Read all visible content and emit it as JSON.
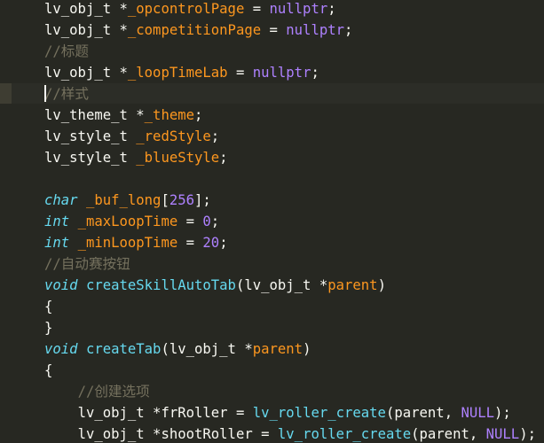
{
  "editor": {
    "lines": [
      {
        "indent": "",
        "tokens": [
          [
            "cls",
            "lv_obj_t"
          ],
          [
            "op",
            " *"
          ],
          [
            "var",
            "_opcontrolPage"
          ],
          [
            "op",
            " = "
          ],
          [
            "kw",
            "nullptr"
          ],
          [
            "punc",
            ";"
          ]
        ]
      },
      {
        "indent": "",
        "tokens": [
          [
            "cls",
            "lv_obj_t"
          ],
          [
            "op",
            " *"
          ],
          [
            "var",
            "_competitionPage"
          ],
          [
            "op",
            " = "
          ],
          [
            "kw",
            "nullptr"
          ],
          [
            "punc",
            ";"
          ]
        ]
      },
      {
        "indent": "",
        "tokens": [
          [
            "com",
            "//标题"
          ]
        ]
      },
      {
        "indent": "",
        "tokens": [
          [
            "cls",
            "lv_obj_t"
          ],
          [
            "op",
            " *"
          ],
          [
            "var",
            "_loopTimeLab"
          ],
          [
            "op",
            " = "
          ],
          [
            "kw",
            "nullptr"
          ],
          [
            "punc",
            ";"
          ]
        ]
      },
      {
        "indent": "",
        "tokens": [
          [
            "com",
            "//样式"
          ]
        ]
      },
      {
        "indent": "",
        "tokens": [
          [
            "cls",
            "lv_theme_t"
          ],
          [
            "op",
            " *"
          ],
          [
            "var",
            "_theme"
          ],
          [
            "punc",
            ";"
          ]
        ]
      },
      {
        "indent": "",
        "tokens": [
          [
            "cls",
            "lv_style_t"
          ],
          [
            "plain",
            " "
          ],
          [
            "var",
            "_redStyle"
          ],
          [
            "punc",
            ";"
          ]
        ]
      },
      {
        "indent": "",
        "tokens": [
          [
            "cls",
            "lv_style_t"
          ],
          [
            "plain",
            " "
          ],
          [
            "var",
            "_blueStyle"
          ],
          [
            "punc",
            ";"
          ]
        ]
      },
      {
        "indent": "",
        "tokens": []
      },
      {
        "indent": "",
        "tokens": [
          [
            "type",
            "char"
          ],
          [
            "plain",
            " "
          ],
          [
            "var",
            "_buf_long"
          ],
          [
            "punc",
            "["
          ],
          [
            "num",
            "256"
          ],
          [
            "punc",
            "];"
          ]
        ]
      },
      {
        "indent": "",
        "tokens": [
          [
            "type",
            "int"
          ],
          [
            "plain",
            " "
          ],
          [
            "var",
            "_maxLoopTime"
          ],
          [
            "op",
            " = "
          ],
          [
            "num",
            "0"
          ],
          [
            "punc",
            ";"
          ]
        ]
      },
      {
        "indent": "",
        "tokens": [
          [
            "type",
            "int"
          ],
          [
            "plain",
            " "
          ],
          [
            "var",
            "_minLoopTime"
          ],
          [
            "op",
            " = "
          ],
          [
            "num",
            "20"
          ],
          [
            "punc",
            ";"
          ]
        ]
      },
      {
        "indent": "",
        "tokens": [
          [
            "com",
            "//自动赛按钮"
          ]
        ]
      },
      {
        "indent": "",
        "tokens": [
          [
            "type",
            "void"
          ],
          [
            "plain",
            " "
          ],
          [
            "fn",
            "createSkillAutoTab"
          ],
          [
            "punc",
            "("
          ],
          [
            "cls",
            "lv_obj_t"
          ],
          [
            "op",
            " *"
          ],
          [
            "param",
            "parent"
          ],
          [
            "punc",
            ")"
          ]
        ]
      },
      {
        "indent": "",
        "tokens": [
          [
            "punc",
            "{"
          ]
        ]
      },
      {
        "indent": "",
        "tokens": [
          [
            "punc",
            "}"
          ]
        ]
      },
      {
        "indent": "",
        "tokens": [
          [
            "type",
            "void"
          ],
          [
            "plain",
            " "
          ],
          [
            "fn",
            "createTab"
          ],
          [
            "punc",
            "("
          ],
          [
            "cls",
            "lv_obj_t"
          ],
          [
            "op",
            " *"
          ],
          [
            "param",
            "parent"
          ],
          [
            "punc",
            ")"
          ]
        ]
      },
      {
        "indent": "",
        "tokens": [
          [
            "punc",
            "{"
          ]
        ]
      },
      {
        "indent": "    ",
        "tokens": [
          [
            "com",
            "//创建选项"
          ]
        ]
      },
      {
        "indent": "    ",
        "tokens": [
          [
            "cls",
            "lv_obj_t"
          ],
          [
            "op",
            " *"
          ],
          [
            "plain",
            "frRoller"
          ],
          [
            "op",
            " = "
          ],
          [
            "fn",
            "lv_roller_create"
          ],
          [
            "punc",
            "("
          ],
          [
            "plain",
            "parent"
          ],
          [
            "punc",
            ", "
          ],
          [
            "kw",
            "NULL"
          ],
          [
            "punc",
            ");"
          ],
          [
            "plain",
            "    "
          ],
          [
            "com",
            "//"
          ]
        ]
      },
      {
        "indent": "    ",
        "tokens": [
          [
            "cls",
            "lv_obj_t"
          ],
          [
            "op",
            " *"
          ],
          [
            "plain",
            "shootRoller"
          ],
          [
            "op",
            " = "
          ],
          [
            "fn",
            "lv_roller_create"
          ],
          [
            "punc",
            "("
          ],
          [
            "plain",
            "parent"
          ],
          [
            "punc",
            ", "
          ],
          [
            "kw",
            "NULL"
          ],
          [
            "punc",
            ");"
          ],
          [
            "plain",
            " "
          ],
          [
            "com",
            "//"
          ]
        ]
      }
    ]
  }
}
